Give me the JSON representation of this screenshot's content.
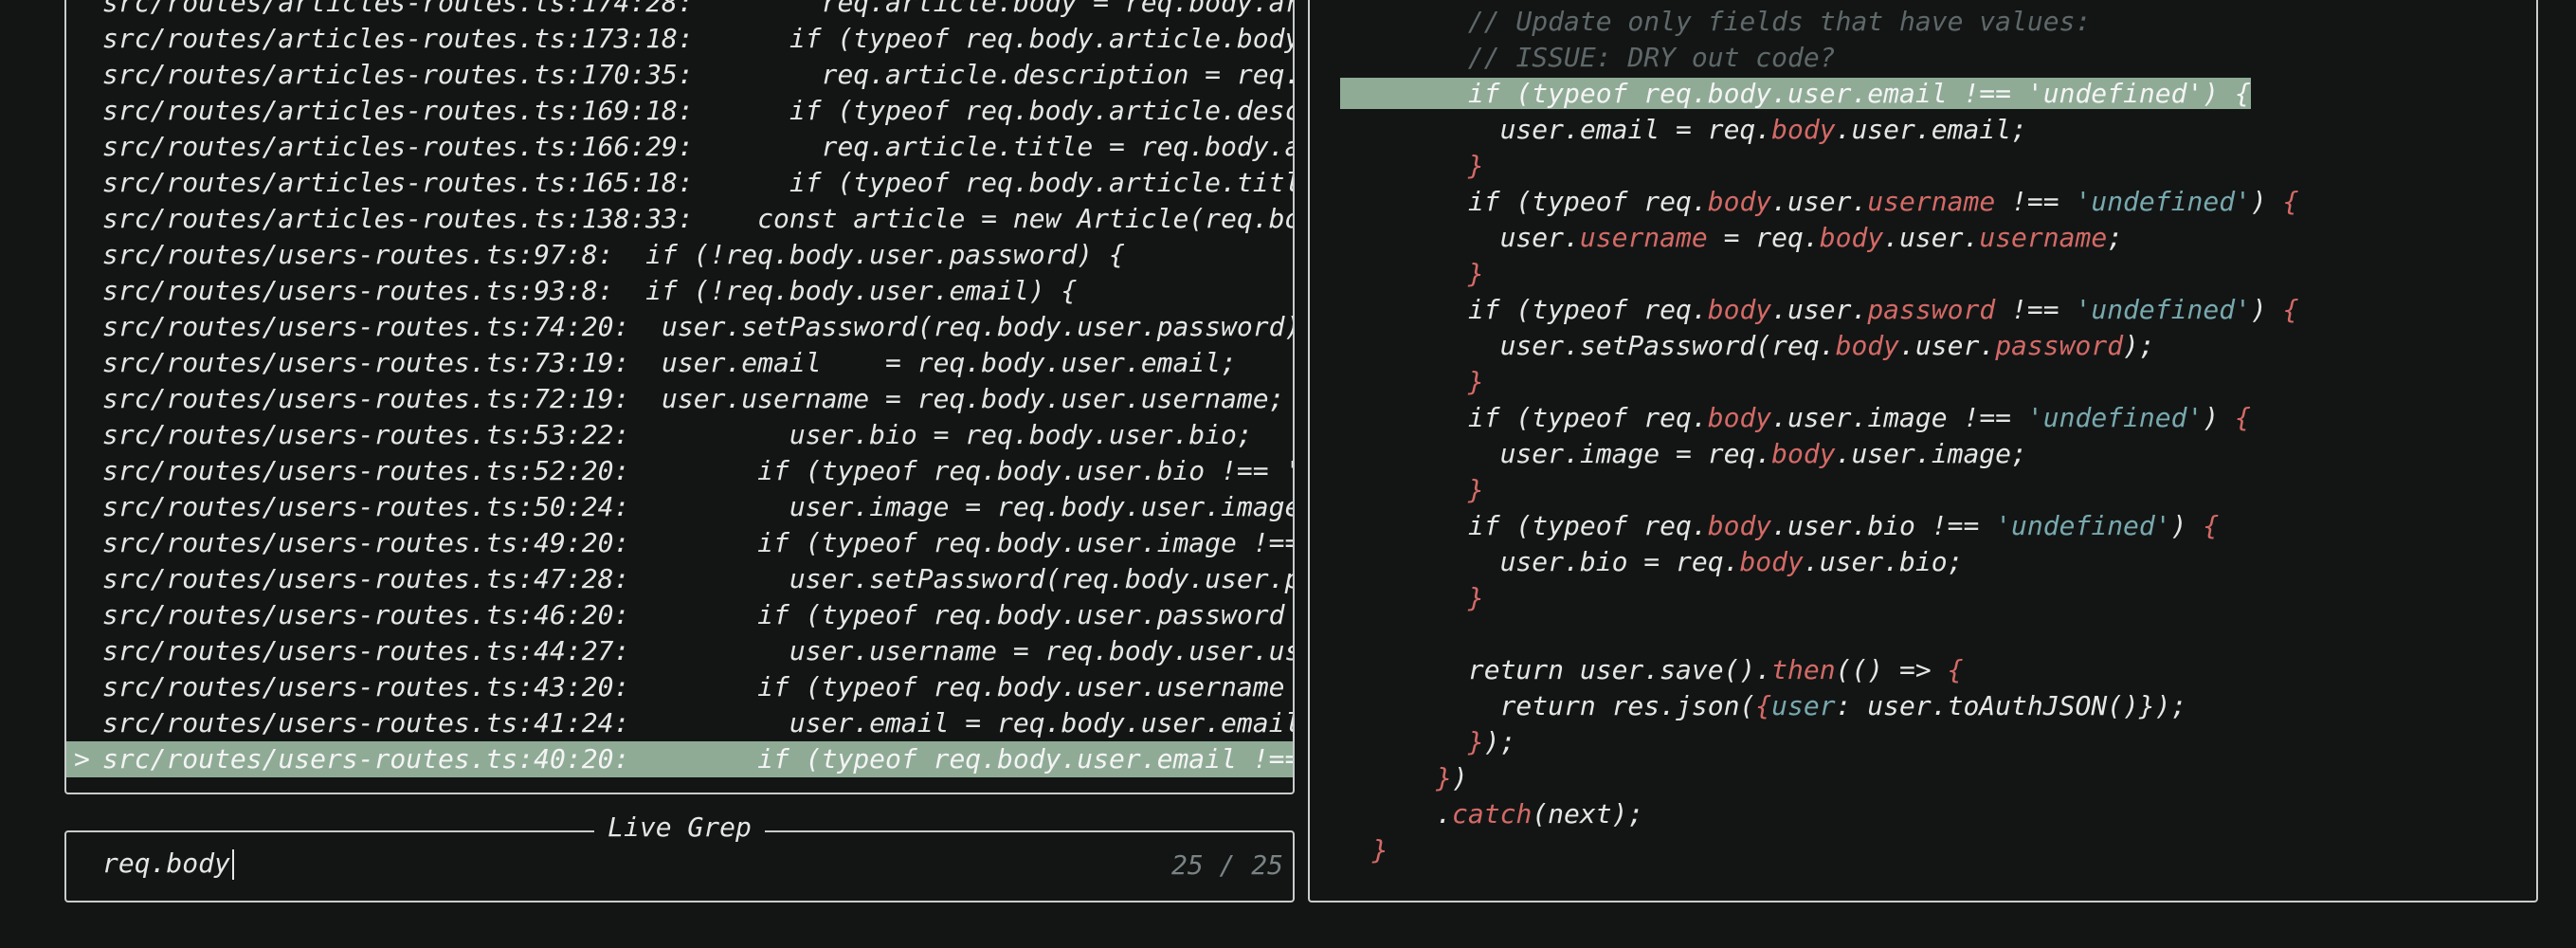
{
  "live_grep": {
    "title": "Live Grep",
    "query": "req.body",
    "count": "25 / 25",
    "results": [
      {
        "loc": "src/routes/articles-routes.ts:174:28:",
        "text": "        req.article.body = req.body.artic"
      },
      {
        "loc": "src/routes/articles-routes.ts:173:18:",
        "text": "      if (typeof req.body.article.body !="
      },
      {
        "loc": "src/routes/articles-routes.ts:170:35:",
        "text": "        req.article.description = req.bod"
      },
      {
        "loc": "src/routes/articles-routes.ts:169:18:",
        "text": "      if (typeof req.body.article.descrip"
      },
      {
        "loc": "src/routes/articles-routes.ts:166:29:",
        "text": "        req.article.title = req.body.arti"
      },
      {
        "loc": "src/routes/articles-routes.ts:165:18:",
        "text": "      if (typeof req.body.article.title !"
      },
      {
        "loc": "src/routes/articles-routes.ts:138:33:",
        "text": "    const article = new Article(req.body."
      },
      {
        "loc": "src/routes/users-routes.ts:97:8:",
        "text": "  if (!req.body.user.password) {"
      },
      {
        "loc": "src/routes/users-routes.ts:93:8:",
        "text": "  if (!req.body.user.email) {"
      },
      {
        "loc": "src/routes/users-routes.ts:74:20:",
        "text": "  user.setPassword(req.body.user.password);"
      },
      {
        "loc": "src/routes/users-routes.ts:73:19:",
        "text": "  user.email    = req.body.user.email;"
      },
      {
        "loc": "src/routes/users-routes.ts:72:19:",
        "text": "  user.username = req.body.user.username;"
      },
      {
        "loc": "src/routes/users-routes.ts:53:22:",
        "text": "          user.bio = req.body.user.bio;"
      },
      {
        "loc": "src/routes/users-routes.ts:52:20:",
        "text": "        if (typeof req.body.user.bio !== 'und"
      },
      {
        "loc": "src/routes/users-routes.ts:50:24:",
        "text": "          user.image = req.body.user.image;"
      },
      {
        "loc": "src/routes/users-routes.ts:49:20:",
        "text": "        if (typeof req.body.user.image !== 'u"
      },
      {
        "loc": "src/routes/users-routes.ts:47:28:",
        "text": "          user.setPassword(req.body.user.pass"
      },
      {
        "loc": "src/routes/users-routes.ts:46:20:",
        "text": "        if (typeof req.body.user.password !=="
      },
      {
        "loc": "src/routes/users-routes.ts:44:27:",
        "text": "          user.username = req.body.user.usern"
      },
      {
        "loc": "src/routes/users-routes.ts:43:20:",
        "text": "        if (typeof req.body.user.username !=="
      },
      {
        "loc": "src/routes/users-routes.ts:41:24:",
        "text": "          user.email = req.body.user.email;"
      },
      {
        "loc": "src/routes/users-routes.ts:40:20:",
        "text": "        if (typeof req.body.user.email !== 'u",
        "selected": true
      }
    ]
  },
  "preview": {
    "lines": [
      {
        "text": "        // Update only fields that have values:",
        "kind": "comment"
      },
      {
        "text": "        // ISSUE: DRY out code?",
        "kind": "comment"
      },
      {
        "text": "        if (typeof req.body.user.email !== 'undefined') {",
        "highlighted": true
      },
      {
        "text": "          user.email = req.body.user.email;"
      },
      {
        "text": "        }"
      },
      {
        "text": "        if (typeof req.body.user.username !== 'undefined') {"
      },
      {
        "text": "          user.username = req.body.user.username;"
      },
      {
        "text": "        }"
      },
      {
        "text": "        if (typeof req.body.user.password !== 'undefined') {"
      },
      {
        "text": "          user.setPassword(req.body.user.password);"
      },
      {
        "text": "        }"
      },
      {
        "text": "        if (typeof req.body.user.image !== 'undefined') {"
      },
      {
        "text": "          user.image = req.body.user.image;"
      },
      {
        "text": "        }"
      },
      {
        "text": "        if (typeof req.body.user.bio !== 'undefined') {"
      },
      {
        "text": "          user.bio = req.body.user.bio;"
      },
      {
        "text": "        }"
      },
      {
        "text": ""
      },
      {
        "text": "        return user.save().then(() => {"
      },
      {
        "text": "          return res.json({user: user.toAuthJSON()});"
      },
      {
        "text": "        });"
      },
      {
        "text": "      })"
      },
      {
        "text": "      .catch(next);"
      },
      {
        "text": "  }"
      }
    ]
  },
  "colors": {
    "background": "#131515",
    "selection": "#8fab96",
    "string": "#78a9ae",
    "accent": "#d46a66",
    "comment": "#5f6869"
  }
}
